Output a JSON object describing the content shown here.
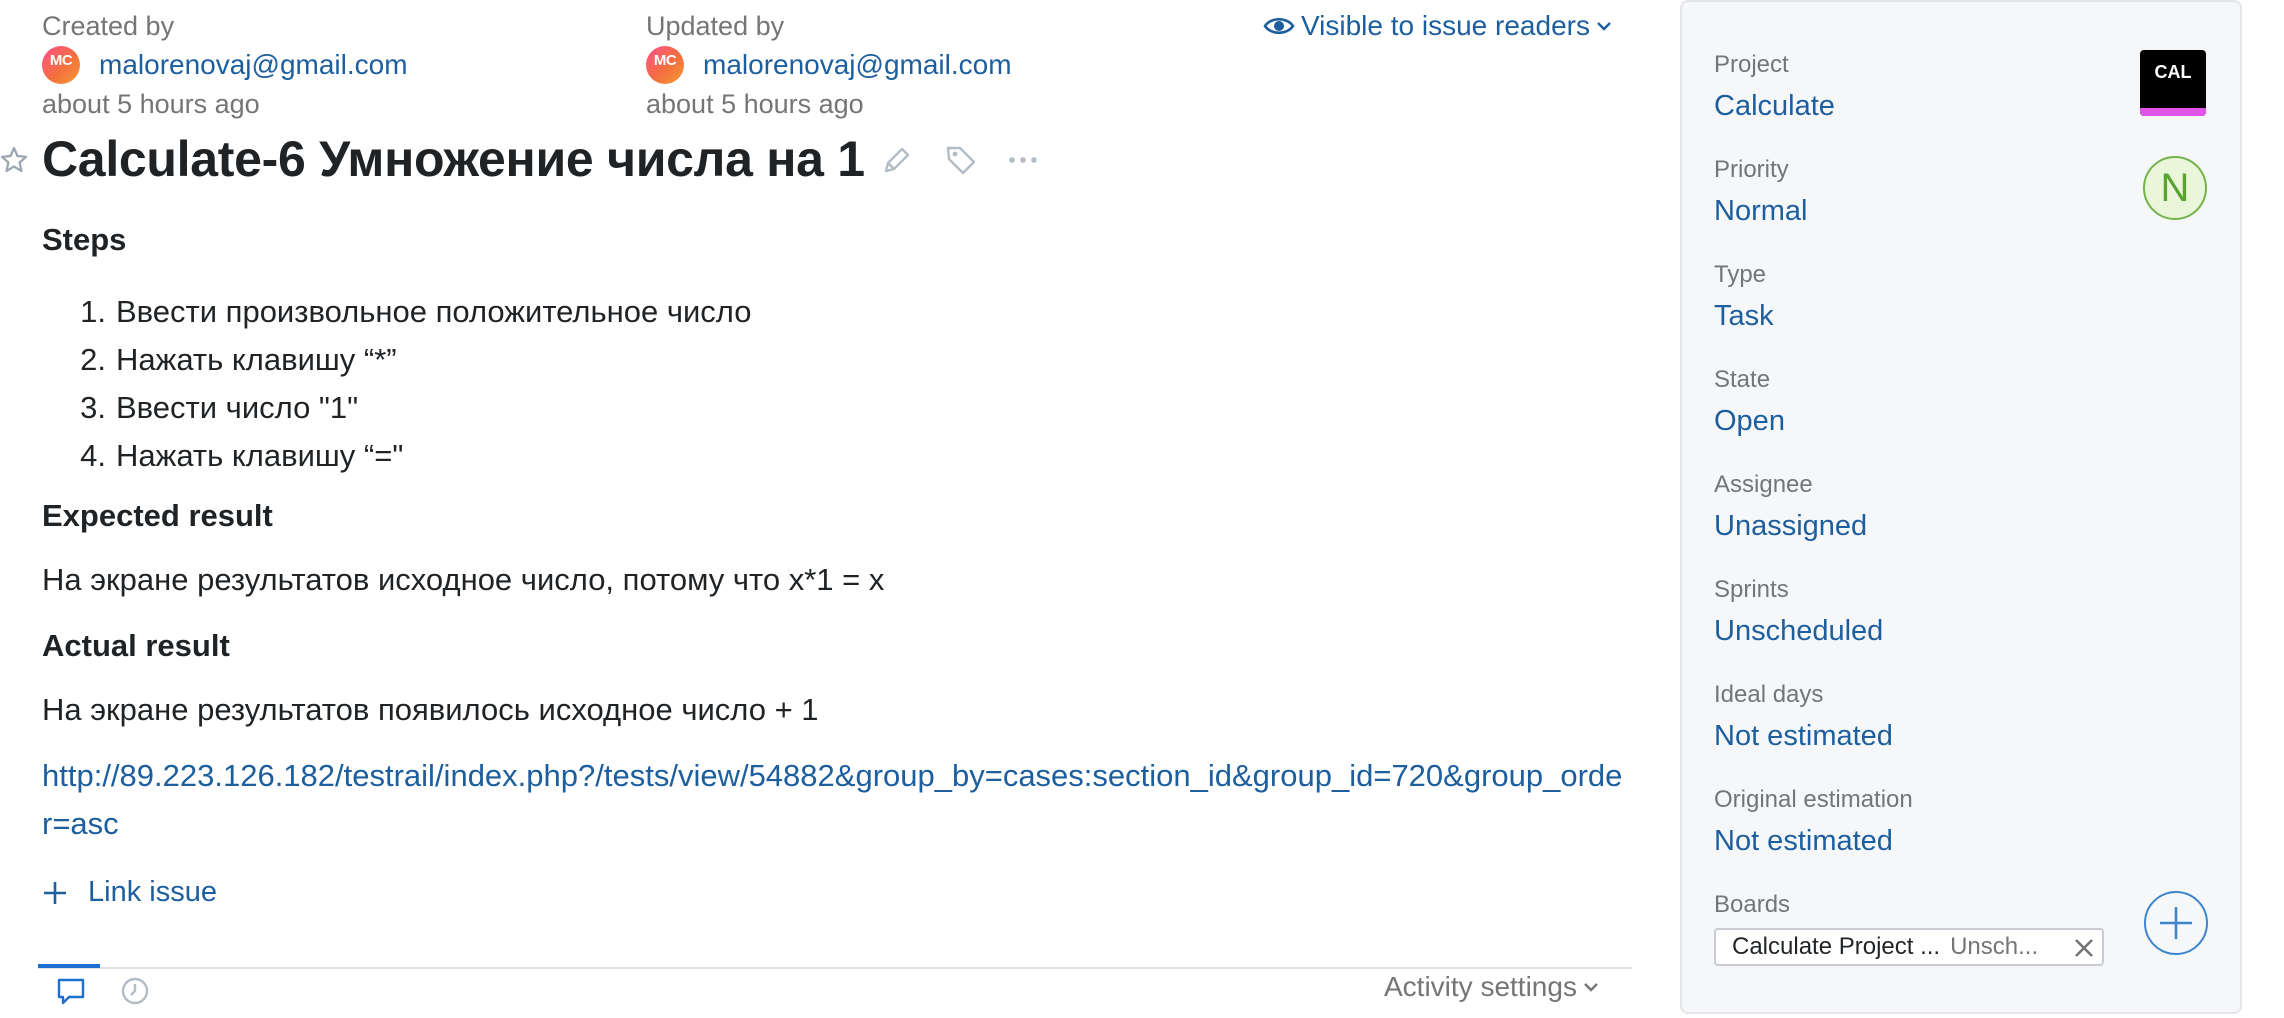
{
  "meta": {
    "created_label": "Created by",
    "created_avatar": "MC",
    "created_user": "malorenovaj@gmail.com",
    "created_time": "about 5 hours ago",
    "updated_label": "Updated by",
    "updated_avatar": "MC",
    "updated_user": "malorenovaj@gmail.com",
    "updated_time": "about 5 hours ago",
    "visibility": "Visible to issue readers"
  },
  "issue": {
    "title": "Calculate-6 Умножение числа на 1",
    "steps_heading": "Steps",
    "steps": [
      {
        "num": "1.",
        "text": "Ввести произвольное положительное число"
      },
      {
        "num": "2.",
        "text": "Нажать клавишу “*”"
      },
      {
        "num": "3.",
        "text": "Ввести число \"1\""
      },
      {
        "num": "4.",
        "text": "Нажать клавишу “=\""
      }
    ],
    "expected_heading": "Expected result",
    "expected_text": "На экране результатов исходное число, потому что x*1 = x",
    "actual_heading": "Actual result",
    "actual_text": "На экране результатов появилось исходное число + 1",
    "url": "http://89.223.126.182/testrail/index.php?/tests/view/54882&group_by=cases:section_id&group_id=720&group_order=asc",
    "link_issue_label": "Link issue"
  },
  "activity": {
    "settings_label": "Activity settings"
  },
  "sidebar": {
    "project_label": "Project",
    "project_value": "Calculate",
    "project_icon_text": "CAL",
    "priority_label": "Priority",
    "priority_value": "Normal",
    "priority_badge": "N",
    "type_label": "Type",
    "type_value": "Task",
    "state_label": "State",
    "state_value": "Open",
    "assignee_label": "Assignee",
    "assignee_value": "Unassigned",
    "sprints_label": "Sprints",
    "sprints_value": "Unscheduled",
    "ideal_label": "Ideal days",
    "ideal_value": "Not estimated",
    "orig_label": "Original estimation",
    "orig_value": "Not estimated",
    "boards_label": "Boards",
    "board_name": "Calculate Project ...",
    "board_sprint": "Unsch..."
  },
  "colors": {
    "link": "#1c5e9e",
    "accent": "#1c6fcf",
    "project_icon_bg": "#000000",
    "project_icon_stripe": "#e055e8",
    "priority_green": "#58a331"
  },
  "icons": {
    "visibility": "eye-icon",
    "favorite": "star-icon",
    "edit": "pencil-icon",
    "tags": "tag-icon",
    "more": "ellipsis-icon",
    "link_issue": "plus-icon",
    "comments": "comment-icon",
    "history": "clock-icon",
    "remove_board": "close-icon",
    "add_board": "plus-circle-icon"
  }
}
